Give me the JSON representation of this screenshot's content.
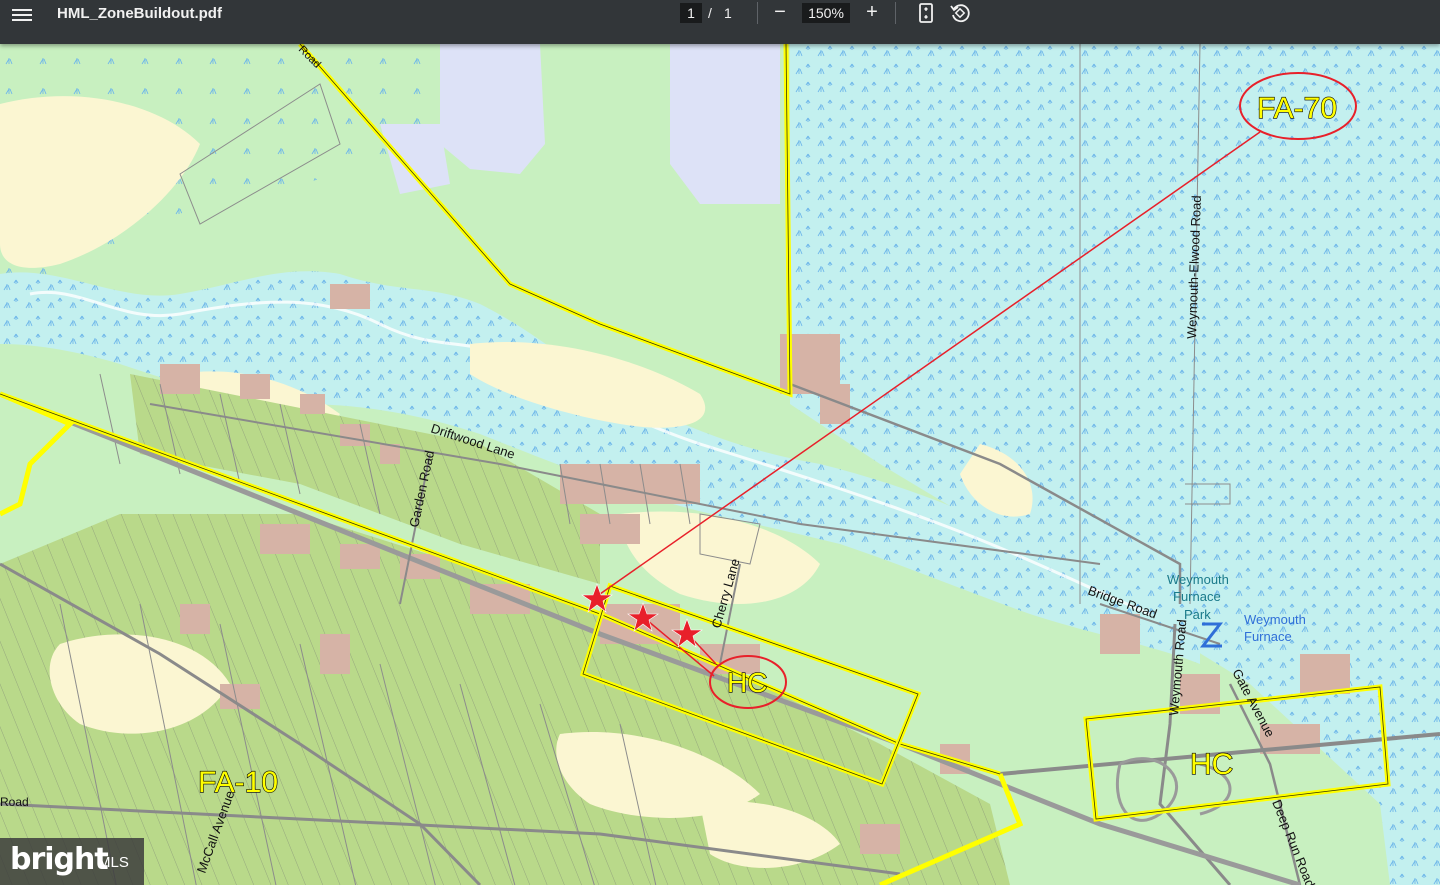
{
  "viewer": {
    "title": "HML_ZoneBuildout.pdf",
    "page_current": "1",
    "page_separator": "/",
    "page_total": "1",
    "zoom": "150%",
    "zoom_out_symbol": "−",
    "zoom_in_symbol": "+"
  },
  "map": {
    "zone_labels": {
      "fa70": "FA-70",
      "hc_west": "HC",
      "hc_east": "HC",
      "fa10": "FA-10"
    },
    "roads": {
      "driftwood": "Driftwood Lane",
      "garden": "Garden Road",
      "cherry": "Cherry Lane",
      "weymouth_elwood": "Weymouth-Elwood Road",
      "bridge": "Bridge Road",
      "weymouth": "Weymouth Road",
      "gate": "Gate Avenue",
      "deep_run": "Deep Run Road",
      "mccall": "McCall Avenue",
      "road_top": "Road",
      "road_left": "Road"
    },
    "places": {
      "park_line1": "Weymouth",
      "park_line2": "Furnace",
      "park_line3": "Park",
      "furnace_line1": "Weymouth",
      "furnace_line2": "Furnace"
    },
    "colors": {
      "wetland": "#c3f0ef",
      "upland": "#c8f0c0",
      "developed": "#d6b3a6",
      "farmland": "#b9d98a",
      "sand": "#fbf6d2",
      "lake": "#dde2f7",
      "zone_line": "#ffff00",
      "marker": "#e8202a"
    },
    "markers": 3
  },
  "watermark": {
    "brand": "bright",
    "suffix": "MLS"
  }
}
